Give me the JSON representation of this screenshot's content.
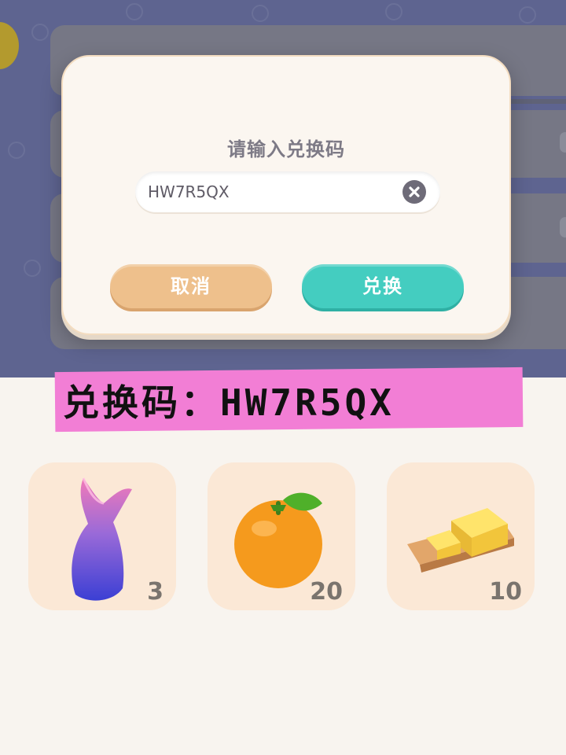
{
  "dialog": {
    "title": "请输入兑换码",
    "code_value": "HW7R5QX",
    "clear_icon": "clear-x-icon",
    "cancel_label": "取消",
    "confirm_label": "兑换"
  },
  "banner": {
    "text": "兑换码：HW7R5QX",
    "color": "#f27ed5"
  },
  "rewards": [
    {
      "item": "mermaid-tail-icon",
      "quantity": "3"
    },
    {
      "item": "orange-icon",
      "quantity": "20"
    },
    {
      "item": "butter-icon",
      "quantity": "10"
    }
  ],
  "colors": {
    "cancel": "#eec08c",
    "confirm": "#44cdc0",
    "card": "#fbe8d6"
  }
}
